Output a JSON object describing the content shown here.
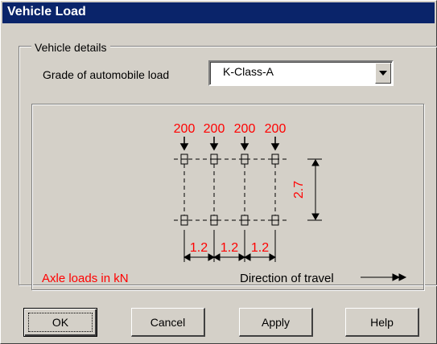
{
  "window": {
    "title": "Vehicle Load"
  },
  "group": {
    "legend": "Vehicle details",
    "grade_label": "Grade of automobile load"
  },
  "grade_select": {
    "value": "K-Class-A"
  },
  "diagram": {
    "axle_loads": [
      "200",
      "200",
      "200",
      "200"
    ],
    "spacings": [
      "1.2",
      "1.2",
      "1.2"
    ],
    "transverse_spacing": "2.7",
    "axle_loads_caption": "Axle loads in kN",
    "direction_caption": "Direction of travel",
    "accent_color": "#ff0000"
  },
  "buttons": {
    "ok": "OK",
    "cancel": "Cancel",
    "apply": "Apply",
    "help": "Help"
  }
}
